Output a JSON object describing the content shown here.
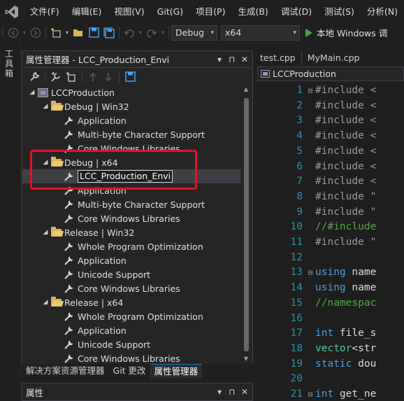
{
  "menubar": {
    "items": [
      "文件(F)",
      "编辑(E)",
      "视图(V)",
      "Git(G)",
      "项目(P)",
      "生成(B)",
      "调试(D)",
      "测试(S)",
      "分析(N)"
    ]
  },
  "toolbar": {
    "config": "Debug",
    "platform": "x64",
    "run_label": "本地 Windows 调"
  },
  "side_strip": {
    "label": "工具箱"
  },
  "property_manager": {
    "title": "属性管理器 - LCC_Production_Envi",
    "pin": "▾ ⊓ ✕",
    "tree": [
      {
        "kind": "project",
        "level": 0,
        "expanded": true,
        "label": "LCCProduction"
      },
      {
        "kind": "folder",
        "level": 1,
        "expanded": true,
        "label": "Debug | Win32"
      },
      {
        "kind": "sheet",
        "level": 2,
        "label": "Application"
      },
      {
        "kind": "sheet",
        "level": 2,
        "label": "Multi-byte Character Support"
      },
      {
        "kind": "sheet",
        "level": 2,
        "label": "Core Windows Libraries"
      },
      {
        "kind": "folder",
        "level": 1,
        "expanded": true,
        "label": "Debug | x64"
      },
      {
        "kind": "sheet",
        "level": 2,
        "label": "LCC_Production_Envi",
        "editing": true
      },
      {
        "kind": "sheet",
        "level": 2,
        "label": "Application"
      },
      {
        "kind": "sheet",
        "level": 2,
        "label": "Multi-byte Character Support"
      },
      {
        "kind": "sheet",
        "level": 2,
        "label": "Core Windows Libraries"
      },
      {
        "kind": "folder",
        "level": 1,
        "expanded": true,
        "label": "Release | Win32"
      },
      {
        "kind": "sheet",
        "level": 2,
        "label": "Whole Program Optimization"
      },
      {
        "kind": "sheet",
        "level": 2,
        "label": "Application"
      },
      {
        "kind": "sheet",
        "level": 2,
        "label": "Unicode Support"
      },
      {
        "kind": "sheet",
        "level": 2,
        "label": "Core Windows Libraries"
      },
      {
        "kind": "folder",
        "level": 1,
        "expanded": true,
        "label": "Release | x64"
      },
      {
        "kind": "sheet",
        "level": 2,
        "label": "Whole Program Optimization"
      },
      {
        "kind": "sheet",
        "level": 2,
        "label": "Application"
      },
      {
        "kind": "sheet",
        "level": 2,
        "label": "Unicode Support"
      },
      {
        "kind": "sheet",
        "level": 2,
        "label": "Core Windows Libraries"
      }
    ]
  },
  "bottom_tabs": [
    "解决方案资源管理器",
    "Git 更改",
    "属性管理器"
  ],
  "properties_panel": {
    "title": "属性"
  },
  "editor": {
    "tabs": [
      "test.cpp",
      "MyMain.cpp"
    ],
    "nav_label": "LCCProduction",
    "lines": [
      {
        "n": "1",
        "fold": "⊟",
        "parts": [
          [
            "pp",
            "#include <"
          ]
        ]
      },
      {
        "n": "2",
        "fold": "",
        "parts": [
          [
            "pp",
            "#include <"
          ]
        ]
      },
      {
        "n": "3",
        "fold": "",
        "parts": [
          [
            "pp",
            "#include <"
          ]
        ]
      },
      {
        "n": "4",
        "fold": "",
        "parts": [
          [
            "pp",
            "#include <"
          ]
        ]
      },
      {
        "n": "5",
        "fold": "",
        "parts": [
          [
            "pp",
            "#include <"
          ]
        ]
      },
      {
        "n": "6",
        "fold": "",
        "parts": [
          [
            "pp",
            "#include <"
          ]
        ]
      },
      {
        "n": "7",
        "fold": "",
        "parts": [
          [
            "pp",
            "#include <"
          ]
        ]
      },
      {
        "n": "8",
        "fold": "",
        "parts": [
          [
            "pp",
            "#include \""
          ]
        ]
      },
      {
        "n": "9",
        "fold": "",
        "parts": [
          [
            "pp",
            "#include \""
          ]
        ]
      },
      {
        "n": "10",
        "fold": "",
        "parts": [
          [
            "cm",
            "//#include"
          ]
        ]
      },
      {
        "n": "11",
        "fold": "",
        "parts": [
          [
            "pp",
            "#include \""
          ]
        ]
      },
      {
        "n": "12",
        "fold": "",
        "parts": []
      },
      {
        "n": "13",
        "fold": "⊟",
        "parts": [
          [
            "kw",
            "using"
          ],
          [
            "tx",
            " name"
          ]
        ]
      },
      {
        "n": "14",
        "fold": "",
        "parts": [
          [
            "kw",
            "using"
          ],
          [
            "tx",
            " name"
          ]
        ]
      },
      {
        "n": "15",
        "fold": "",
        "parts": [
          [
            "cm",
            "//namespac"
          ]
        ]
      },
      {
        "n": "16",
        "fold": "",
        "parts": []
      },
      {
        "n": "17",
        "fold": "",
        "parts": [
          [
            "kw",
            "int"
          ],
          [
            "tx",
            " file_s"
          ]
        ]
      },
      {
        "n": "18",
        "fold": "",
        "parts": [
          [
            "ty",
            "vector"
          ],
          [
            "tx",
            "<str"
          ]
        ]
      },
      {
        "n": "19",
        "fold": "",
        "parts": [
          [
            "kw",
            "static"
          ],
          [
            "tx",
            " dou"
          ]
        ]
      },
      {
        "n": "20",
        "fold": "",
        "parts": []
      },
      {
        "n": "21",
        "fold": "⊟",
        "parts": [
          [
            "kw",
            "int"
          ],
          [
            "tx",
            " get_ne"
          ]
        ]
      }
    ]
  }
}
